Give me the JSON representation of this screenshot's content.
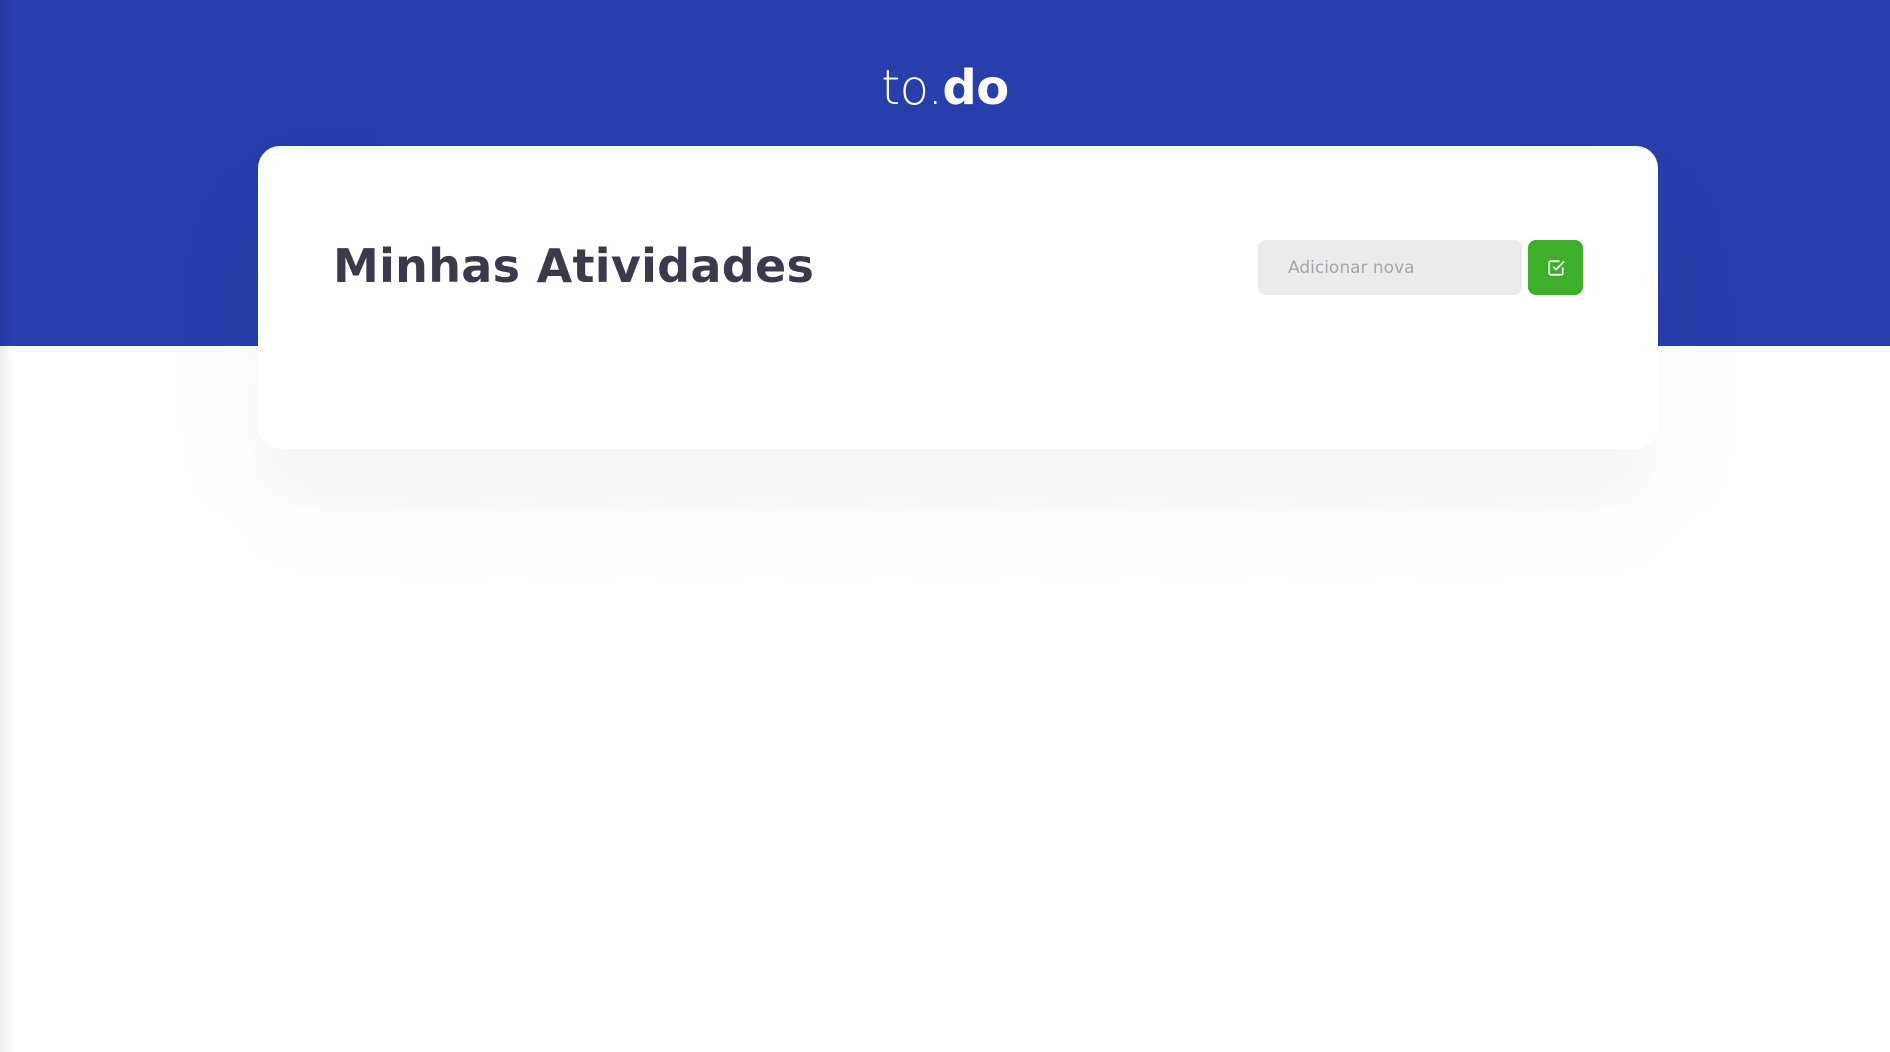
{
  "header": {
    "logo_light": "to.",
    "logo_bold": "do",
    "background_color": "#273fad"
  },
  "card": {
    "title": "Minhas Atividades"
  },
  "add_form": {
    "input_placeholder": "Adicionar nova",
    "input_value": "",
    "submit_icon": "check-square-icon",
    "submit_color": "#3fae2a"
  }
}
